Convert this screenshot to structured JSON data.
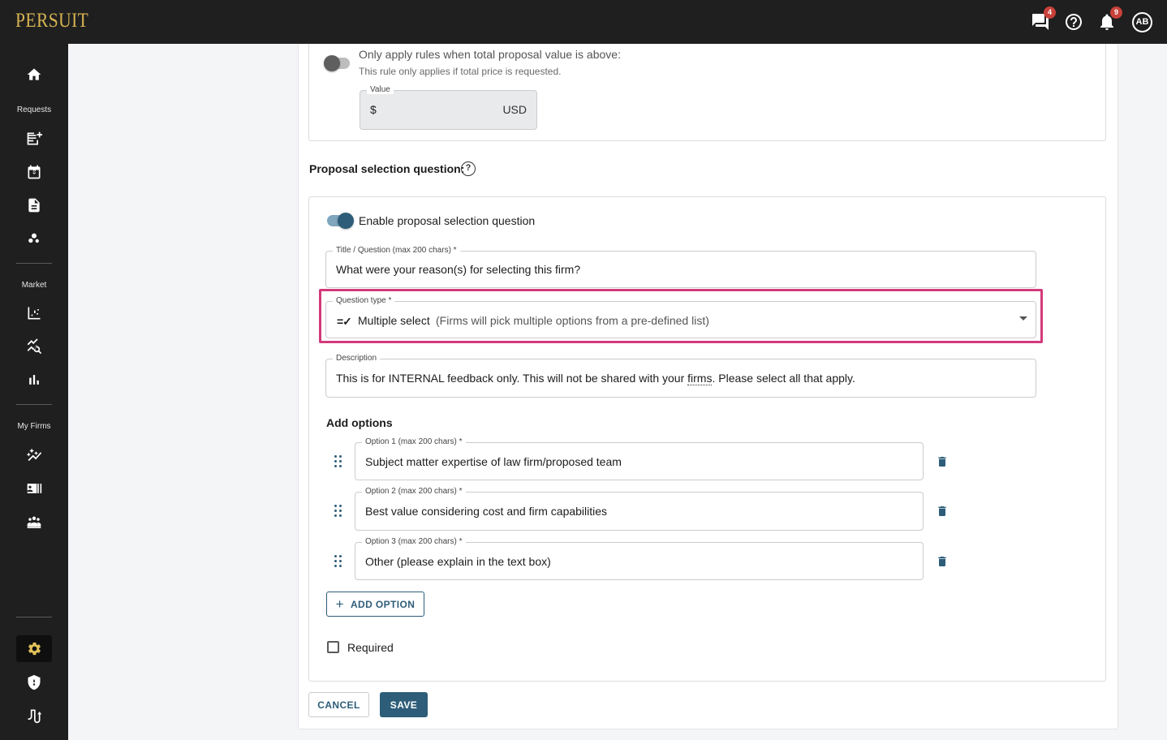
{
  "app": {
    "logo": "PERSUIT",
    "messages_badge": "4",
    "notifications_badge": "9",
    "avatar_initials": "AB"
  },
  "sidebar": {
    "sections": {
      "requests": "Requests",
      "market": "Market",
      "my_firms": "My Firms"
    },
    "icons": [
      "home-icon",
      "new-request-icon",
      "price-calendar-icon",
      "document-icon",
      "scatter-icon",
      "chart-line-icon",
      "analytics-search-icon",
      "bar-chart-icon",
      "auto-graph-icon",
      "contact-card-icon",
      "team-icon",
      "settings-icon",
      "security-icon",
      "workflow-icon"
    ]
  },
  "value_rule": {
    "toggle_label": "Only apply rules when total proposal value is above:",
    "toggle_hint": "This rule only applies if total price is requested.",
    "value_label": "Value",
    "currency_symbol": "$",
    "currency_code": "USD"
  },
  "proposal_section": {
    "heading": "Proposal selection question:",
    "enable_label": "Enable proposal selection question",
    "title_field": {
      "label": "Title / Question (max 200 chars) *",
      "value": "What were your reason(s) for selecting this firm?"
    },
    "question_type": {
      "label": "Question type *",
      "selected": "Multiple select",
      "selected_hint": "(Firms will pick multiple options from a pre-defined list)"
    },
    "description": {
      "label": "Description",
      "value_before": "This is for INTERNAL feedback only. This will not be shared with your ",
      "value_link": "firms",
      "value_after": ". Please select all that apply."
    },
    "options_heading": "Add options",
    "options": [
      {
        "label": "Option 1 (max 200 chars) *",
        "value": "Subject matter expertise of law firm/proposed team"
      },
      {
        "label": "Option 2 (max 200 chars) *",
        "value": "Best value considering cost and firm capabilities"
      },
      {
        "label": "Option 3 (max 200 chars) *",
        "value": "Other (please explain in the text box)"
      }
    ],
    "add_option_label": "ADD OPTION",
    "required_label": "Required"
  },
  "actions": {
    "cancel_label": "CANCEL",
    "save_label": "SAVE"
  },
  "colors": {
    "accent": "#2d5d79",
    "highlight": "#d23a7a",
    "logo": "#d7b452",
    "badge": "#c8413a"
  }
}
